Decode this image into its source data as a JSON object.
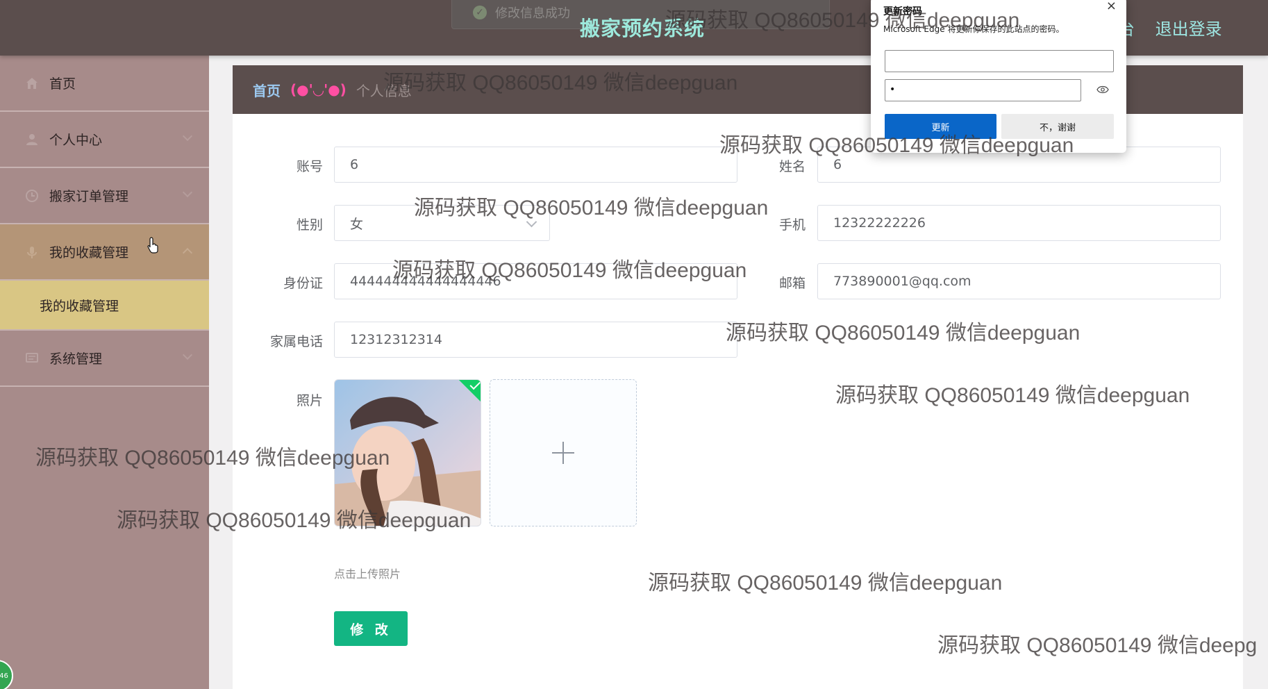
{
  "header": {
    "toast_text": "修改信息成功",
    "app_title": "搬家预约系统",
    "nav_backend": "台",
    "nav_logout": "退出登录"
  },
  "sidebar": {
    "items": [
      {
        "label": "首页",
        "icon": "home-icon"
      },
      {
        "label": "个人中心",
        "icon": "user-icon"
      },
      {
        "label": "搬家订单管理",
        "icon": "clock-icon"
      },
      {
        "label": "我的收藏管理",
        "icon": "mic-icon"
      },
      {
        "label": "系统管理",
        "icon": "chat-icon"
      }
    ],
    "submenu_item": "我的收藏管理",
    "badge_text": "46"
  },
  "breadcrumb": {
    "home": "首页",
    "emoticon": "(●'◡'●)",
    "current": "个人信息"
  },
  "form": {
    "account_label": "账号",
    "account_value": "6",
    "name_label": "姓名",
    "name_value": "6",
    "gender_label": "性别",
    "gender_value": "女",
    "phone_label": "手机",
    "phone_value": "12322222226",
    "idcard_label": "身份证",
    "idcard_value": "444444444444444446",
    "email_label": "邮箱",
    "email_value": "773890001@qq.com",
    "family_phone_label": "家属电话",
    "family_phone_value": "12312312314",
    "photo_label": "照片",
    "upload_hint": "点击上传照片",
    "submit_label": "修 改"
  },
  "popup": {
    "title": "更新密码",
    "description": "Microsoft Edge 将更新你保存的此站点的密码。",
    "password_mask": "•",
    "update_label": "更新",
    "no_thanks_label": "不，谢谢"
  },
  "watermark": {
    "text": "源码获取 QQ86050149 微信deepguan",
    "text_cut": "源码获取 QQ86050149 微信deepg"
  },
  "colors": {
    "header_bg": "#5b4e4d",
    "sidebar_bg": "#a78b8a",
    "submenu_active": "#d9c684",
    "title_color": "#9de9dc",
    "submit_btn": "#13b583"
  }
}
